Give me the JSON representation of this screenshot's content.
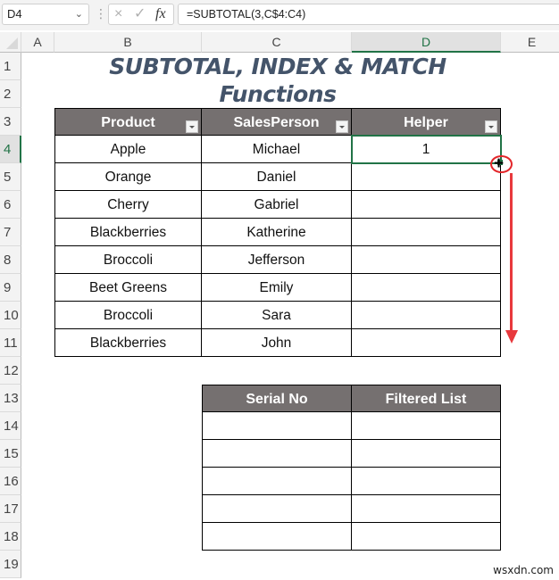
{
  "formula_bar": {
    "name_box": "D4",
    "cancel_icon": "×",
    "enter_icon": "✓",
    "fx_label": "fx",
    "formula": "=SUBTOTAL(3,C$4:C4)"
  },
  "columns": [
    "A",
    "B",
    "C",
    "D",
    "E"
  ],
  "selected_column": "D",
  "rows": [
    "1",
    "2",
    "3",
    "4",
    "5",
    "6",
    "7",
    "8",
    "9",
    "10",
    "11",
    "12",
    "13",
    "14",
    "15",
    "16",
    "17",
    "18",
    "19"
  ],
  "selected_row": "4",
  "sheet": {
    "title": "SUBTOTAL, INDEX & MATCH Functions",
    "main_table": {
      "headers": [
        "Product",
        "SalesPerson",
        "Helper"
      ],
      "rows": [
        [
          "Apple",
          "Michael",
          "1"
        ],
        [
          "Orange",
          "Daniel",
          ""
        ],
        [
          "Cherry",
          "Gabriel",
          ""
        ],
        [
          "Blackberries",
          "Katherine",
          ""
        ],
        [
          "Broccoli",
          "Jefferson",
          ""
        ],
        [
          "Beet Greens",
          "Emily",
          ""
        ],
        [
          "Broccoli",
          "Sara",
          ""
        ],
        [
          "Blackberries",
          "John",
          ""
        ]
      ]
    },
    "result_table": {
      "headers": [
        "Serial No",
        "Filtered List"
      ],
      "rows": [
        [
          "",
          ""
        ],
        [
          "",
          ""
        ],
        [
          "",
          ""
        ],
        [
          "",
          ""
        ],
        [
          "",
          ""
        ]
      ]
    }
  },
  "colors": {
    "header_fill": "#757070",
    "title_color": "#44546a",
    "selection": "#217346",
    "annotation": "#e8393d"
  },
  "watermark": "wsxdn.com"
}
